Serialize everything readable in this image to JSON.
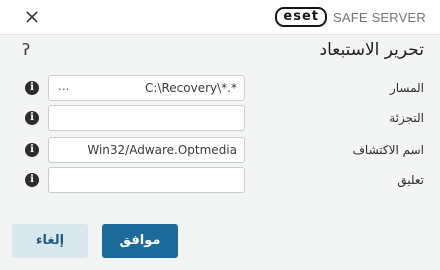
{
  "window": {
    "brand_logo": "eset",
    "product_name": "SAFE SERVER",
    "close_icon": "close-icon"
  },
  "dialog": {
    "title": "تحرير الاستبعاد",
    "help_icon": "help-question-icon"
  },
  "form": {
    "rows": [
      {
        "label": "المسار",
        "value": "C:\\Recovery\\*.*",
        "browse": "...",
        "info_icon": "info-icon"
      },
      {
        "label": "التجزئة",
        "value": "",
        "info_icon": "info-icon"
      },
      {
        "label": "اسم الاكتشاف",
        "value": "Win32/Adware.Optmedia",
        "info_icon": "info-icon"
      },
      {
        "label": "تعليق",
        "value": "",
        "info_icon": "info-icon"
      }
    ]
  },
  "buttons": {
    "ok_label": "موافق",
    "cancel_label": "إلغاء"
  },
  "colors": {
    "primary_button": "#1b6a9a",
    "secondary_button": "#dbe7ee",
    "background": "#f3f4f4"
  }
}
